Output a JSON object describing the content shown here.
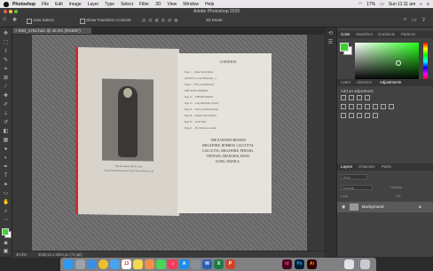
{
  "menubar": {
    "app_name": "Photoshop",
    "menus": [
      "File",
      "Edit",
      "Image",
      "Layer",
      "Type",
      "Select",
      "Filter",
      "3D",
      "View",
      "Window",
      "Help"
    ],
    "battery": "17%",
    "clock": "Sun 11:11 am"
  },
  "window": {
    "title": "Adobe Photoshop 2020"
  },
  "options": {
    "auto_select_label": "Auto-Select:",
    "show_transform_label": "Show Transform Controls",
    "mode_label": "3D Mode:"
  },
  "document": {
    "tab_title": "IMG_4762.heic @ 40.3% (RGB/8*)",
    "zoom": "40.3%",
    "dimensions": "4032 px x 3024 px (72 ppi)"
  },
  "book": {
    "left_caption_1": "Her Excellency Mt. R. Kan",
    "left_caption_2": "Consecrated Missionary of the Church Mary Lord",
    "right_title": "CONTENTS",
    "right_lines": [
      "Page 1. . . Under Native Rulers",
      "(Written by a Lady Missionary ...)",
      "Page 8. . . The Lady Missionary",
      "THE CROSS, BOMBAY",
      "Page 12. . . THE PROVINCES",
      "Page 17. . . Lady Missionary Society",
      "Page 21. . . Native Christian Women",
      "Page 28. . . Punjab Central District",
      "Page 35. . . In the Field",
      "Page 41. . . By whom we are aided"
    ],
    "right_block_title": "THE EASTERN MISSION",
    "right_block_lines": [
      "SINGAPORE, BOMBAY, CALCUTTA,",
      "CALCUTTA, SINGAPORE, PENANG,",
      "TIENTSIN, SHANGHAI, HONG",
      "KONG, MANILA."
    ]
  },
  "panels": {
    "color_tabs": [
      "Color",
      "Swatches",
      "Gradients",
      "Patterns"
    ],
    "adj_tabs": [
      "Learn",
      "Libraries",
      "Adjustments"
    ],
    "adj_hint": "Add an adjustment",
    "layer_tabs": [
      "Layers",
      "Channels",
      "Paths"
    ],
    "kind_label": "Kind",
    "mode_label": "Normal",
    "opacity_label": "Opacity:",
    "lock_label": "Lock:",
    "fill_label": "Fill:",
    "layer_name": "Background"
  },
  "colors": {
    "foreground": "#3bd334",
    "background": "#ffffff",
    "accent": "#2f7bd8"
  },
  "dock": {
    "apps": [
      "finder-icon",
      "launchpad-icon",
      "safari-icon",
      "chrome-icon",
      "mail-icon",
      "calendar-icon",
      "notes-icon",
      "photos-icon",
      "messages-icon",
      "music-icon",
      "appstore-icon",
      "settings-icon",
      "word-icon",
      "excel-icon",
      "powerpoint-icon",
      "indesign-icon",
      "photoshop-icon",
      "illustrator-icon",
      "preview-icon",
      "trash-icon"
    ],
    "calendar_day": "13",
    "labels": {
      "indesign": "Id",
      "photoshop": "Ps",
      "illustrator": "Ai",
      "word": "W",
      "excel": "X",
      "powerpoint": "P",
      "appstore": "A",
      "music": "♫"
    }
  }
}
